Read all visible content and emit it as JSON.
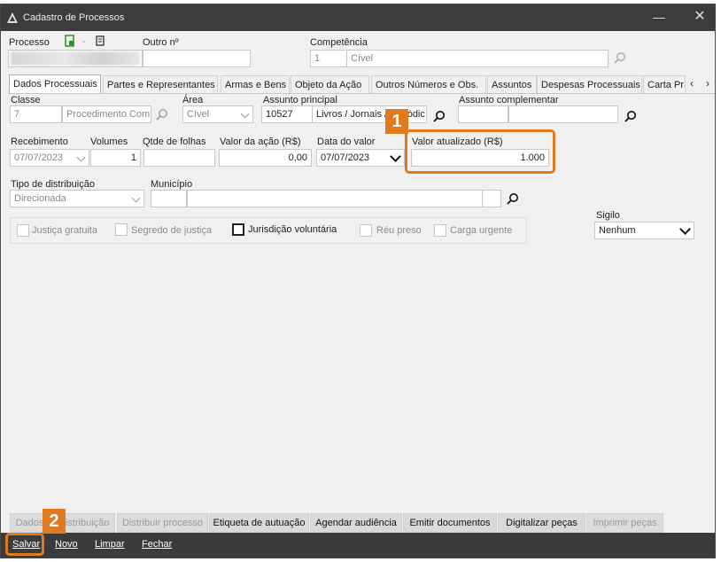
{
  "window": {
    "title": "Cadastro de Processos",
    "minimize": "—",
    "close": "✕"
  },
  "header": {
    "processo_label": "Processo",
    "outro_label": "Outro nº",
    "competencia_label": "Competência",
    "competencia_code": "1",
    "competencia_value": "Cível"
  },
  "tabs": [
    {
      "label": "Dados Processuais"
    },
    {
      "label": "Partes e Representantes"
    },
    {
      "label": "Armas e Bens"
    },
    {
      "label": "Objeto da Ação"
    },
    {
      "label": "Outros Números e Obs."
    },
    {
      "label": "Assuntos"
    },
    {
      "label": "Despesas Processuais"
    },
    {
      "label": "Carta Pr"
    }
  ],
  "form": {
    "classe_label": "Classe",
    "classe_code": "7",
    "classe_value": "Procedimento Com",
    "area_label": "Área",
    "area_value": "Cível",
    "assunto_principal_label": "Assunto principal",
    "assunto_code": "10527",
    "assunto_value": "Livros / Jornais / Periódic",
    "assunto_complementar_label": "Assunto complementar",
    "recebimento_label": "Recebimento",
    "recebimento_value": "07/07/2023",
    "volumes_label": "Volumes",
    "volumes_value": "1",
    "qtde_folhas_label": "Qtde de folhas",
    "valor_acao_label": "Valor da ação (R$)",
    "valor_acao_value": "0,00",
    "data_valor_label": "Data do valor",
    "data_valor_value": "07/07/2023",
    "valor_atualizado_label": "Valor atualizado (R$)",
    "valor_atualizado_value": "1.000",
    "tipo_distribuicao_label": "Tipo de distribuição",
    "tipo_distribuicao_value": "Direcionada",
    "municipio_label": "Município",
    "sigilo_label": "Sigilo",
    "sigilo_value": "Nenhum"
  },
  "checks": [
    {
      "label": "Justiça gratuita"
    },
    {
      "label": "Segredo de justiça"
    },
    {
      "label": "Jurisdição voluntária"
    },
    {
      "label": "Réu preso"
    },
    {
      "label": "Carga urgente"
    }
  ],
  "bottom_buttons": [
    {
      "label": "Dados da distribuição"
    },
    {
      "label": "Distribuir processo"
    },
    {
      "label": "Etiqueta de autuação"
    },
    {
      "label": "Agendar audiência"
    },
    {
      "label": "Emitir documentos"
    },
    {
      "label": "Digitalizar peças"
    },
    {
      "label": "Imprimir peças"
    }
  ],
  "actions": [
    {
      "label": "Salvar"
    },
    {
      "label": "Novo"
    },
    {
      "label": "Limpar"
    },
    {
      "label": "Fechar"
    }
  ],
  "badges": {
    "one": "1",
    "two": "2"
  },
  "colors": {
    "titlebar": "#3c3c3c",
    "callout": "#e07a1f",
    "actionbar": "#3b3b3b"
  }
}
